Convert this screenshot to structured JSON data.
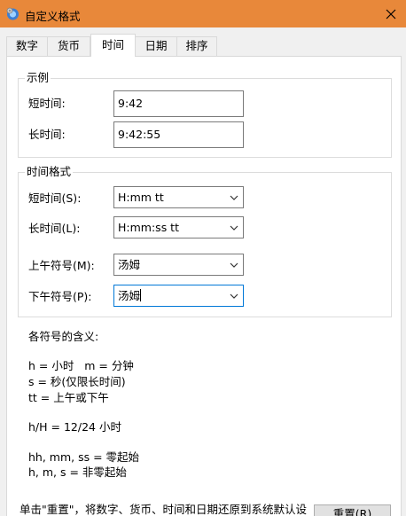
{
  "window": {
    "title": "自定义格式",
    "title_bar_color": "#e8883a"
  },
  "tabs": [
    {
      "label": "数字",
      "active": false
    },
    {
      "label": "货币",
      "active": false
    },
    {
      "label": "时间",
      "active": true
    },
    {
      "label": "日期",
      "active": false
    },
    {
      "label": "排序",
      "active": false
    }
  ],
  "sample": {
    "group_title": "示例",
    "short_label": "短时间:",
    "short_value": "9:42",
    "long_label": "长时间:",
    "long_value": "9:42:55"
  },
  "formats": {
    "group_title": "时间格式",
    "short_label": "短时间(S):",
    "short_value": "H:mm tt",
    "long_label": "长时间(L):",
    "long_value": "H:mm:ss tt",
    "am_label": "上午符号(M):",
    "am_value": "汤姆",
    "pm_label": "下午符号(P):",
    "pm_value": "汤姆"
  },
  "notes": {
    "heading": "各符号的含义:",
    "line1": "h = 小时   m = 分钟",
    "line2": "s = 秒(仅限长时间)",
    "line3": "tt = 上午或下午",
    "line4": "h/H = 12/24 小时",
    "line5": "hh, mm, ss = 零起始",
    "line6": "h, m, s = 非零起始"
  },
  "footer": {
    "description": "单击\"重置\"，将数字、货币、时间和日期还原到系统默认设",
    "reset_label": "重置(R)"
  },
  "icons": {
    "app": "settings-app-icon",
    "close": "close-icon",
    "dropdown": "chevron-down-icon"
  }
}
